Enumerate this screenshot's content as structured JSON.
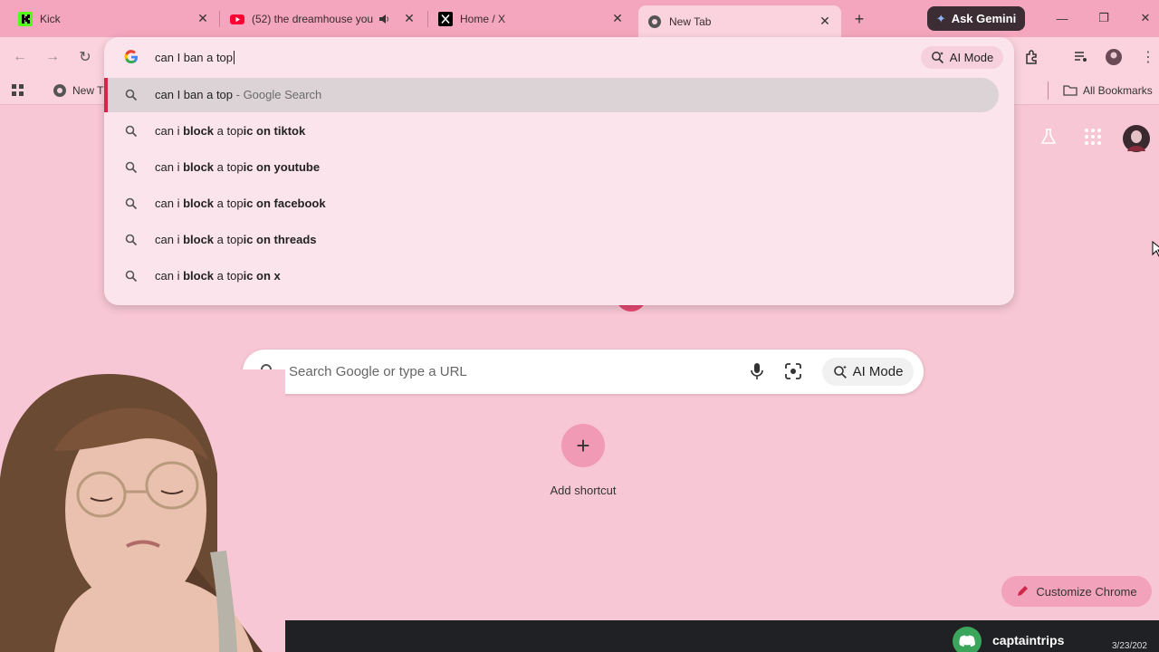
{
  "tabs": [
    {
      "title": "Kick",
      "favicon": "kick-icon"
    },
    {
      "title": "(52) the dreamhouse you",
      "favicon": "youtube-icon",
      "audio": true
    },
    {
      "title": "Home / X",
      "favicon": "x-icon"
    },
    {
      "title": "New Tab",
      "favicon": "chrome-icon",
      "active": true
    }
  ],
  "gemini_button": "Ask Gemini",
  "omnibox": {
    "typed": "can I ban a top",
    "ai_mode": "AI Mode",
    "suggestions": [
      {
        "pre": "can I ban a top",
        "suffix": " - Google Search",
        "bold": ""
      },
      {
        "pre": "can i ",
        "b1": "block",
        "mid": " a top",
        "b2": "ic on tiktok"
      },
      {
        "pre": "can i ",
        "b1": "block",
        "mid": " a top",
        "b2": "ic on youtube"
      },
      {
        "pre": "can i ",
        "b1": "block",
        "mid": " a top",
        "b2": "ic on facebook"
      },
      {
        "pre": "can i ",
        "b1": "block",
        "mid": " a top",
        "b2": "ic on threads"
      },
      {
        "pre": "can i ",
        "b1": "block",
        "mid": " a top",
        "b2": "ic on x"
      }
    ]
  },
  "bookmarks": {
    "partial_item": "New T",
    "all_bookmarks": "All Bookmarks"
  },
  "ntp": {
    "search_placeholder": "Search Google or type a URL",
    "ai_mode": "AI Mode",
    "add_shortcut": "Add shortcut",
    "customize": "Customize Chrome"
  },
  "taskbar": {
    "discord_user": "captaintrips",
    "clock": "3/23/202"
  },
  "colors": {
    "accent": "#d0284a",
    "tabstrip": "#f3a6bd",
    "page": "#f8c7d6"
  }
}
